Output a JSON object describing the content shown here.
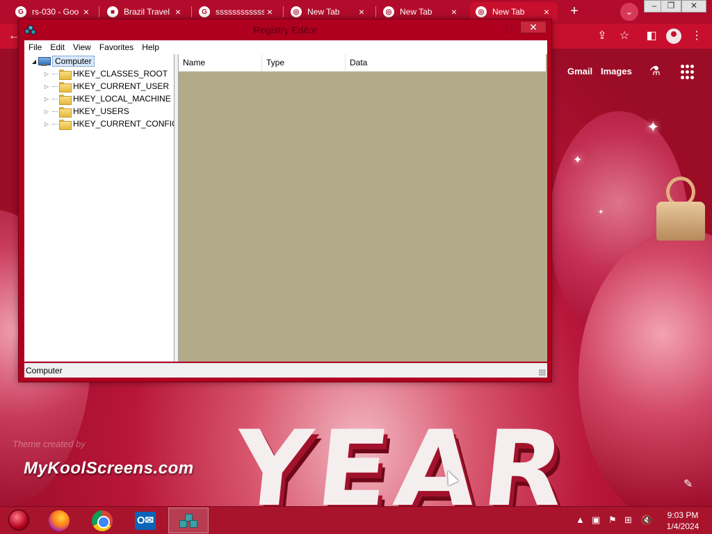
{
  "browser": {
    "tabs": [
      {
        "title": "rs-030 - Goo",
        "favicon": "G"
      },
      {
        "title": "Brazil Travel",
        "favicon": "■"
      },
      {
        "title": "ssssssssssssss",
        "favicon": "G"
      },
      {
        "title": "New Tab",
        "favicon": "◎"
      },
      {
        "title": "New Tab",
        "favicon": "◎"
      },
      {
        "title": "New Tab",
        "favicon": "◎"
      }
    ],
    "links": {
      "gmail": "Gmail",
      "images": "Images"
    }
  },
  "regedit": {
    "title": "Registry Editor",
    "menu": [
      "File",
      "Edit",
      "View",
      "Favorites",
      "Help"
    ],
    "tree": {
      "root": "Computer",
      "keys": [
        "HKEY_CLASSES_ROOT",
        "HKEY_CURRENT_USER",
        "HKEY_LOCAL_MACHINE",
        "HKEY_USERS",
        "HKEY_CURRENT_CONFIG"
      ]
    },
    "columns": [
      "Name",
      "Type",
      "Data"
    ],
    "status": "Computer"
  },
  "wallpaper": {
    "theme_credit": "Theme created by",
    "site": "MyKoolScreens.com",
    "word": "YEAR"
  },
  "taskbar": {
    "clock_time": "9:03 PM",
    "clock_date": "1/4/2024"
  }
}
